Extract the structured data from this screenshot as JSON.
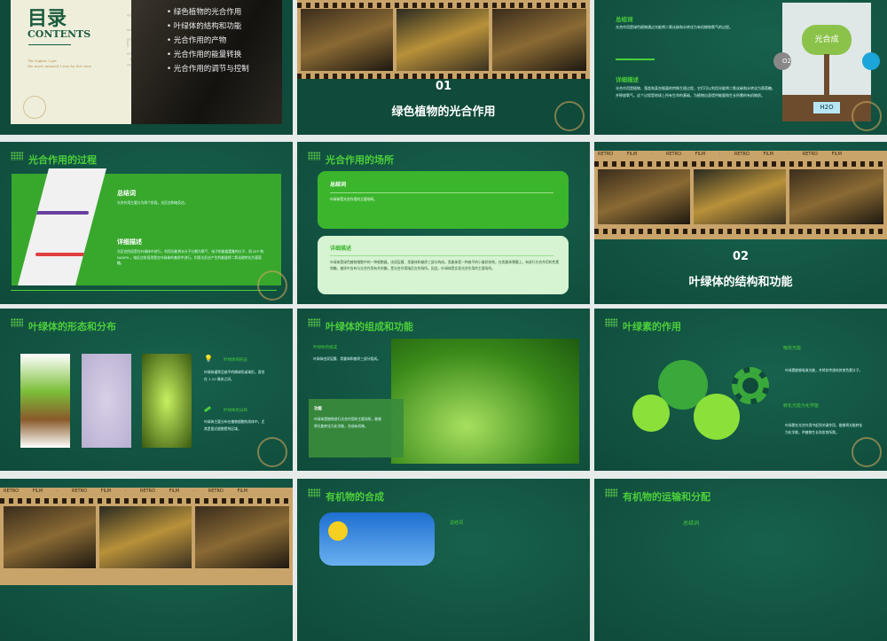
{
  "slides": {
    "toc": {
      "title": "目录",
      "subtitle": "CONTENTS",
      "quote1": "The higher I got",
      "quote2": "the more amazed I was by the view.",
      "watermark": "FILM",
      "items": [
        "绿色植物的光合作用",
        "叶绿体的结构和功能",
        "光合作用的产物",
        "光合作用的能量转换",
        "光合作用的调节与控制"
      ]
    },
    "sec1": {
      "num": "01",
      "title": "绿色植物的光合作用"
    },
    "intro": {
      "h1": "总结词",
      "p1": "光合作用是绿色植物通过光能将二氧化碳和水转化为有机物和氧气的过程。",
      "h2": "详细描述",
      "p2": "光合作用是植物、藻类和某些细菌的特殊生理过程，它们可以利用光能将二氧化碳和水转化为葡萄糖，并释放氧气。这个过程是地球上所有生命的基础，为植物自身提供能量和生长所需的有机物质。",
      "img_center": "光合成",
      "img_co2": "O2",
      "img_h2o": "H2O"
    },
    "process": {
      "title": "光合作用的过程",
      "h1": "总结词",
      "p1": "光合作用主要分为两个阶段，光反应和暗反应。",
      "h2": "详细描述",
      "p2": "光反应阶段是在叶绿体中进行，利用光能将水分子分解为氧气、电子和能量富集的分子，如 ATP 和 NADPH 。暗反应阶段则是在叶绿体的基质中进行，利用光反应产生的能量将二氧化碳转化为葡萄糖。"
    },
    "site": {
      "title": "光合作用的场所",
      "h1": "总结词",
      "p1": "叶绿体是光合作用的主要场所。",
      "h2": "详细描述",
      "p2": "叶绿体是绿色植物细胞中的一种细胞器，由双层膜、类囊体和基质三部分构成。类囊体是一种扁平的小囊状结构，在类囊体薄膜上，有进行光合作用的色素和酶。基质中含有与光合作用有关的酶，是光合作用暗反应的场所。因此，叶绿体是实现光合作用的主要场所。"
    },
    "sec2": {
      "strip": "RETRO FILM",
      "num": "02",
      "title": "叶绿体的结构和功能"
    },
    "shape": {
      "title": "叶绿体的形态和分布",
      "h1": "叶绿体的形态",
      "p1": "叶绿体通常呈扁平的椭球形或球形，直径在 1-10 微米之间。",
      "h2": "叶绿体的分布",
      "p2": "叶绿体主要分布在植物细胞的质体中，尤其是靠近细胞壁的区域。"
    },
    "comp": {
      "title": "叶绿体的组成和功能",
      "h1": "叶绿体的组成",
      "p1": "叶绿体由双层膜、类囊体和基质三部分组成。",
      "h2": "功能",
      "p2": "叶绿体是植物进行光合作用的主要场所，能够将光能转化为化学能，合成有机物。"
    },
    "pigment": {
      "title": "叶绿素的作用",
      "h1": "吸收光能",
      "p1": "叶绿素能够吸收光能，并将其传递给其他色素分子。",
      "h2": "转化光能为化学能",
      "p2": "叶绿素在光合作用中起到关键作用，能够将光能转化为化学能，供植物生长和发育所需。"
    },
    "sec3": {
      "strip": "RETRO FILM"
    },
    "synth": {
      "title": "有机物的合成",
      "h1": "总结词"
    },
    "transport": {
      "title": "有机物的运输和分配",
      "h1": "总结词"
    }
  },
  "colors": {
    "bg": "#0f4a3a",
    "accent": "#4ccf3a",
    "gold": "#c9a46a"
  }
}
